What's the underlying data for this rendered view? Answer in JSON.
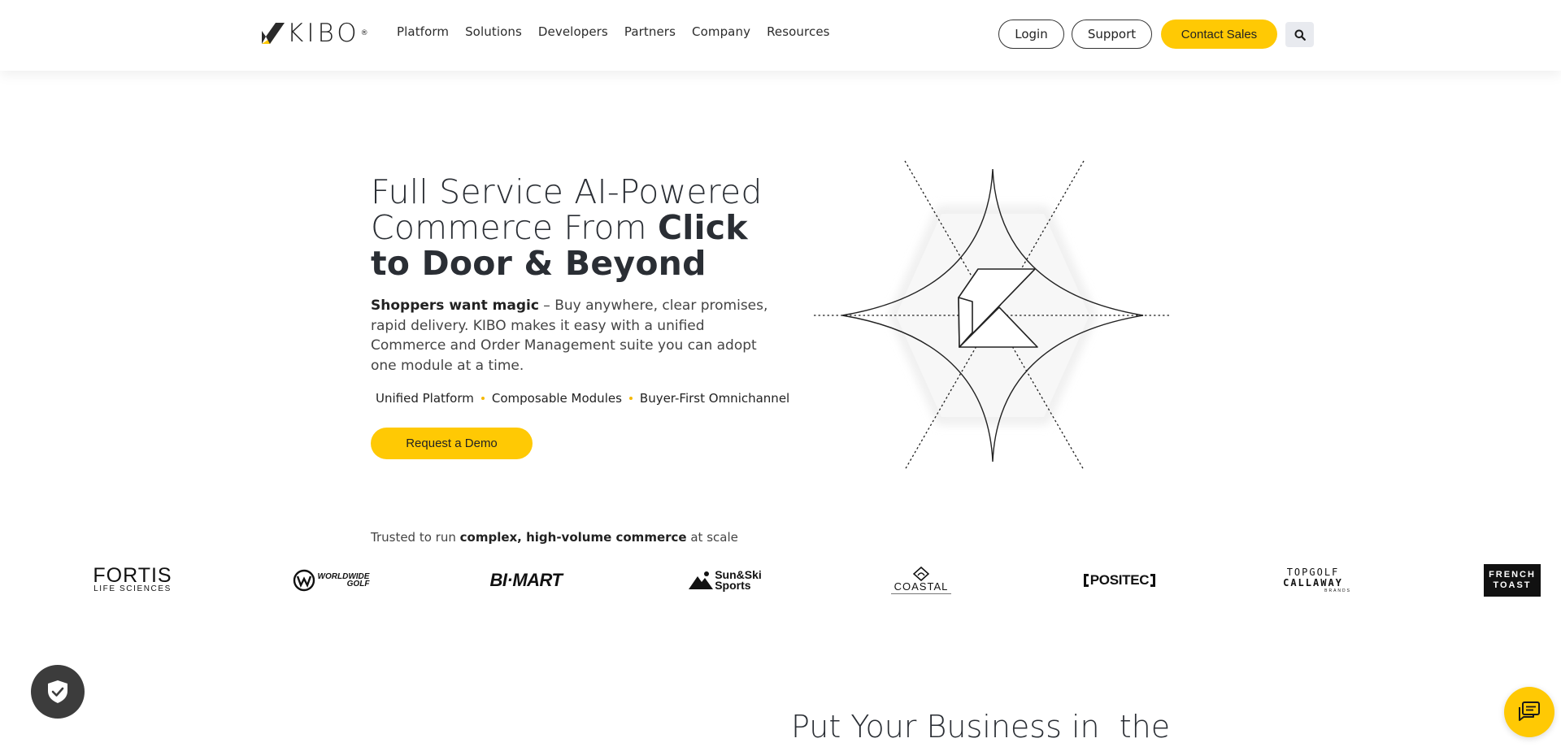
{
  "header": {
    "logo_text": "KIBO",
    "logo_reg": "®",
    "nav": [
      "Platform",
      "Solutions",
      "Developers",
      "Partners",
      "Company",
      "Resources"
    ],
    "login_label": "Login",
    "support_label": "Support",
    "contact_label": "Contact Sales",
    "search_icon": "search-icon",
    "accessibility_icon": "sliders-icon"
  },
  "hero": {
    "title_light_1": "Full Service AI-Powered Commerce From ",
    "title_bold_1": "Click to Door & Beyond",
    "desc_bold": "Shoppers want magic",
    "desc_rest": " – Buy anywhere, clear promises, rapid delivery. KIBO makes it easy with a unified Commerce and Order Management suite you can adopt one module at a time.",
    "pills": [
      "Unified Platform",
      "Composable Modules",
      "Buyer-First Omnichannel"
    ],
    "demo_label": "Request a Demo"
  },
  "trusted": {
    "prefix": "Trusted to run ",
    "bold": "complex, high-volume commerce",
    "suffix": " at scale",
    "brands": {
      "fortis_1": "FORTIS",
      "fortis_2": "LIFE SCIENCES",
      "worldwide_1": "WORLDWIDE",
      "worldwide_2": "GOLF",
      "bimart": "BI·MART",
      "sunski_1": "Sun&Ski",
      "sunski_2": "Sports",
      "coastal": "COASTAL",
      "positec": "POSITEC",
      "topgolf_1": "TOPGOLF",
      "topgolf_2": "CALLAWAY",
      "topgolf_3": "BRANDS",
      "french_1": "FRENCH",
      "french_2": "TOAST"
    }
  },
  "section": {
    "title": "Put Your Business in  the"
  },
  "widgets": {
    "privacy_icon": "shield-check-icon",
    "chat_icon": "chat-icon"
  },
  "colors": {
    "accent": "#ffc904",
    "dark_text": "#2a2e34",
    "access_bg": "#1f2a6b"
  }
}
